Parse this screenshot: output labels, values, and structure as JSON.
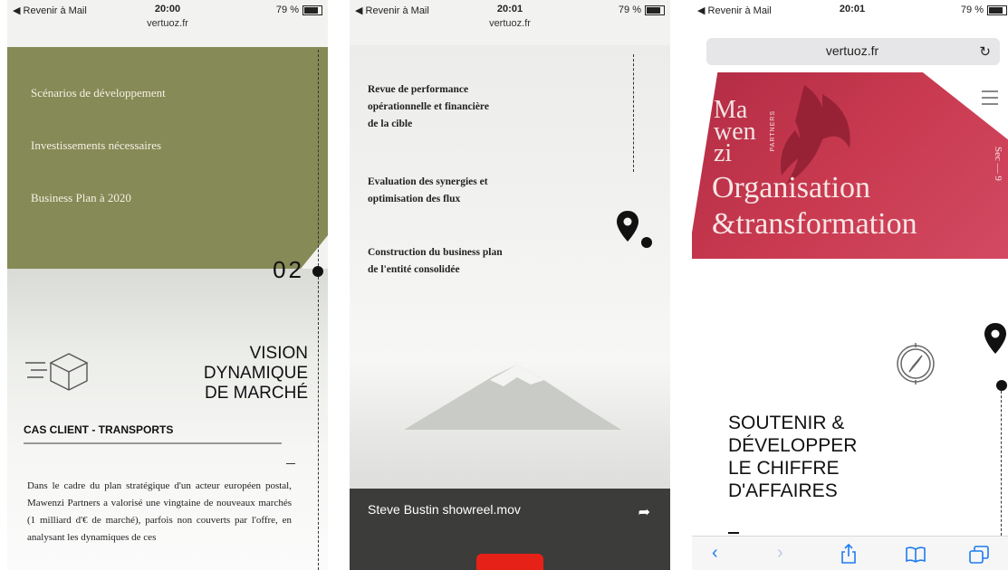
{
  "phones": [
    {
      "status": {
        "back": "◀ Revenir à Mail",
        "time": "20:00",
        "battery": "79 %"
      },
      "url": "vertuoz.fr",
      "menu_items": [
        "Scénarios de développement",
        "Investissements nécessaires",
        "Business Plan à 2020"
      ],
      "number": "02",
      "section_title": [
        "VISION",
        "DYNAMIQUE",
        "DE MARCHÉ"
      ],
      "case_label": "CAS CLIENT - TRANSPORTS",
      "paragraph": "Dans le cadre du plan stratégique d'un acteur européen postal, Mawenzi Partners a valorisé une vingtaine de nouveaux marchés (1 milliard d'€ de marché), parfois non couverts par l'offre, en analysant les dynamiques de ces"
    },
    {
      "status": {
        "back": "◀ Revenir à Mail",
        "time": "20:01",
        "battery": "79 %"
      },
      "url": "vertuoz.fr",
      "items": [
        [
          "Revue de performance",
          "opérationnelle et financière",
          "de la cible"
        ],
        [
          "Evaluation des synergies et",
          "optimisation des flux"
        ],
        [
          "Construction du business plan",
          "de l'entité consolidée"
        ]
      ],
      "video_title": "Steve Bustin showreel.mov"
    },
    {
      "status": {
        "back": "◀ Revenir à Mail",
        "time": "20:01",
        "battery": "79 %"
      },
      "url": "vertuoz.fr",
      "brand": [
        "Ma",
        "wen",
        "zi"
      ],
      "brand_partners": "PARTNERS",
      "side_text": "Sec — 9",
      "hero_title": [
        "Organisation",
        "&transformation"
      ],
      "headline": [
        "SOUTENIR &",
        "DÉVELOPPER",
        "LE CHIFFRE",
        "D'AFFAIRES"
      ],
      "hero_color": "#c93a50"
    }
  ]
}
